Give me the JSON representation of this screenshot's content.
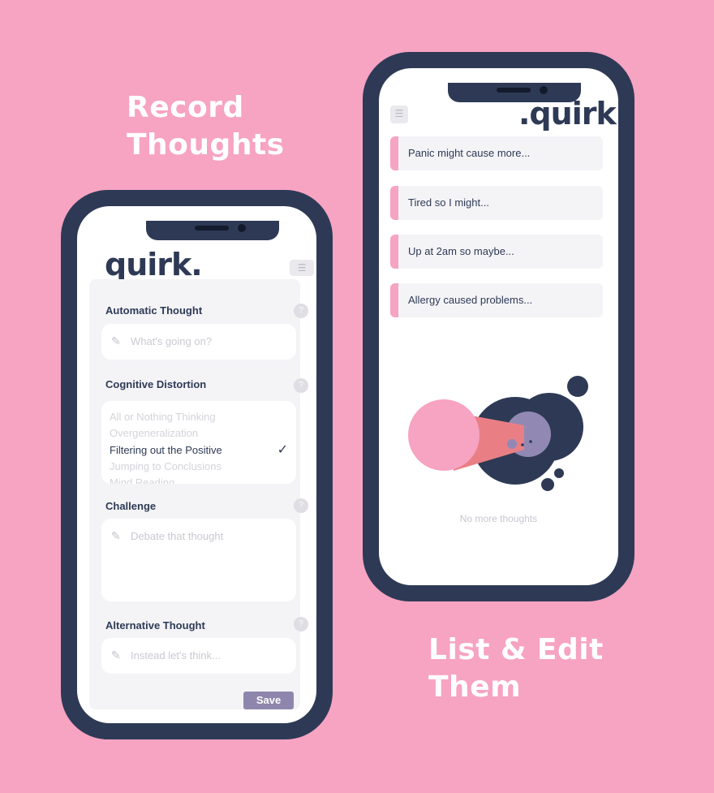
{
  "promo": {
    "left_lines": [
      "Record",
      "Thoughts"
    ],
    "right_lines": [
      "List & Edit",
      "Them"
    ]
  },
  "record_screen": {
    "brand": "quirk.",
    "menu_icon": "menu-icon",
    "sections": {
      "automatic_thought": {
        "label": "Automatic Thought",
        "placeholder": "What's going on?"
      },
      "cognitive_distortion": {
        "label": "Cognitive Distortion",
        "options": [
          "All or Nothing Thinking",
          "Overgeneralization",
          "Filtering out the Positive",
          "Jumping to Conclusions",
          "Mind Reading"
        ],
        "selected": "Filtering out the Positive"
      },
      "challenge": {
        "label": "Challenge",
        "placeholder": "Debate that thought"
      },
      "alternative_thought": {
        "label": "Alternative Thought",
        "placeholder": "Instead let's think..."
      }
    },
    "save_label": "Save"
  },
  "list_screen": {
    "brand": ".quirk",
    "thoughts": [
      "Panic might cause more...",
      "Tired so I might...",
      "Up at 2am so maybe...",
      "Allergy caused problems..."
    ],
    "empty_message": "No more thoughts"
  },
  "colors": {
    "background": "#f7a3c2",
    "navy": "#2e3a55",
    "accent_purple": "#8e86ac",
    "pink": "#f7a3c2"
  }
}
